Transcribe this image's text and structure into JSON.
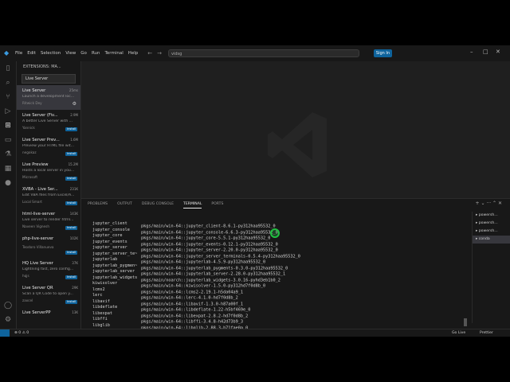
{
  "app": {
    "menu": [
      "File",
      "Edit",
      "Selection",
      "View",
      "Go",
      "Run",
      "Terminal",
      "Help"
    ],
    "search_value": "vidsg",
    "sign_in_label": "Sign In"
  },
  "sidebar": {
    "header": "EXTENSIONS: MA...",
    "search_value": "Live Server",
    "extensions": [
      {
        "name": "Live Server",
        "count": "25ms",
        "desc": "Launch a development loc...",
        "publisher": "Ritwick Dey",
        "action": "gear"
      },
      {
        "name": "Live Server (Fiv...",
        "count": "2.9M",
        "desc": "A better Live Server with ...",
        "publisher": "Yannick",
        "action": "Install"
      },
      {
        "name": "Live Server Prev...",
        "count": "1.6M",
        "desc": "Preview your HTML file wit...",
        "publisher": "negokaz",
        "action": "Install"
      },
      {
        "name": "Live Preview",
        "count": "15.2M",
        "desc": "Hosts a local server in you...",
        "publisher": "Microsoft",
        "action": "Install"
      },
      {
        "name": "XVBA - Live Ser...",
        "count": "231K",
        "desc": "Edit VBA files from Excel/A...",
        "publisher": "Local Smart",
        "action": "Install"
      },
      {
        "name": "html-live-server",
        "count": "143K",
        "desc": "Live server to render html...",
        "publisher": "Naveen Vignesh",
        "action": "Install"
      },
      {
        "name": "php-live-server",
        "count": "102K",
        "desc": "",
        "publisher": "Teodoro Villanueva",
        "action": "Install"
      },
      {
        "name": "HQ Live Server",
        "count": "37K",
        "desc": "Lightning fast, zero config...",
        "publisher": "hqjs",
        "action": "Install"
      },
      {
        "name": "Live Server QR",
        "count": "29K",
        "desc": "Scan a QR Code to open y...",
        "publisher": "zaxcel",
        "action": "Install"
      },
      {
        "name": "Live ServerPP",
        "count": "13K",
        "desc": "",
        "publisher": "",
        "action": ""
      }
    ]
  },
  "panel": {
    "tabs": [
      "PROBLEMS",
      "OUTPUT",
      "DEBUG CONSOLE",
      "TERMINAL",
      "PORTS"
    ],
    "active_tab": "TERMINAL",
    "shells": [
      "powersh...",
      "powersh...",
      "powersh...",
      "conda"
    ],
    "terminal_rows": [
      {
        "pkg": "jupyter_client",
        "path": "pkgs/main/win-64::jupyter_client-8.6.1-py312haa95532_0"
      },
      {
        "pkg": "jupyter_console",
        "path": "pkgs/main/win-64::jupyter_console-6.6.3-py312haa95532_0"
      },
      {
        "pkg": "jupyter_core",
        "path": "pkgs/main/win-64::jupyter_core-5.5.1-py312haa95532_0"
      },
      {
        "pkg": "jupyter_events",
        "path": "pkgs/main/win-64::jupyter_events-0.12.1-py312haa95532_0"
      },
      {
        "pkg": "jupyter_server",
        "path": "pkgs/main/win-64::jupyter_server-2.20.0-py312haa95532_0"
      },
      {
        "pkg": "jupyter_server_te~",
        "path": "pkgs/main/win-64::jupyter_server_terminals-0.5.4-py312haa95532_0"
      },
      {
        "pkg": "jupyterlab",
        "path": "pkgs/main/win-64::jupyterlab-4.5.9-py312haa95532_0"
      },
      {
        "pkg": "jupyterlab_pygmen~",
        "path": "pkgs/main/win-64::jupyterlab_pygments-0.3.0-py312haa95532_0"
      },
      {
        "pkg": "jupyterlab_server",
        "path": "pkgs/main/win-64::jupyterlab_server-2.28.0-py312haa95532_1"
      },
      {
        "pkg": "jupyterlab_widgets",
        "path": "pkgs/main/noarch::jupyterlab_widgets-3.0.16-pyhd3eb1b0_2"
      },
      {
        "pkg": "kiwisolver",
        "path": "pkgs/main/win-64::kiwisolver-1.5.0-py312hd7f0d8b_0"
      },
      {
        "pkg": "lcms2",
        "path": "pkgs/main/win-64::lcms2-2.19.1-h5da04a9_1"
      },
      {
        "pkg": "lerc",
        "path": "pkgs/main/win-64::lerc-4.1.0-hd7f0d8b_2"
      },
      {
        "pkg": "libavif",
        "path": "pkgs/main/win-64::libavif-1.3.0-h87a00f_1"
      },
      {
        "pkg": "libdeflate",
        "path": "pkgs/main/win-64::libdeflate-1.22-h5bf469e_0"
      },
      {
        "pkg": "libexpat",
        "path": "pkgs/main/win-64::libexpat-2.8.2-hd7f0d8b_2"
      },
      {
        "pkg": "libffi",
        "path": "pkgs/main/win-64::libffi-3.4.8-h42d73b9_3"
      },
      {
        "pkg": "libglib",
        "path": "pkgs/main/win-64::libglib-2.88.3-h71fae0a_0"
      },
      {
        "pkg": "libhwloc",
        "path": "pkgs/main/win-64::libhwloc-2.12.1-default_hfa10c62_1000"
      },
      {
        "pkg": "libiconv",
        "path": "pkgs/main/win-64::libiconv-1.18-hc09ec93_0"
      },
      {
        "pkg": "libjpeg-turbo",
        "path": "pkgs/main/win-64::libjpeg-turbo-3.1.3-h02ab6af_0"
      },
      {
        "pkg": "libkrb5",
        "path": "pkgs/main/win-64::libkrb5-1.22.2-h3d0bf0e_0"
      },
      {
        "pkg": "libopenjpeg",
        "path": "pkgs/main/win-64::libopenjpeg-2.5.4-h1c6eee8_1"
      },
      {
        "pkg": "libpng",
        "path": "pkgs/main/win-64::libpng-1.6.56-h2054ad3_0"
      }
    ]
  },
  "statusbar": {
    "go_live": "Go Live",
    "prettier": "Prettier"
  }
}
